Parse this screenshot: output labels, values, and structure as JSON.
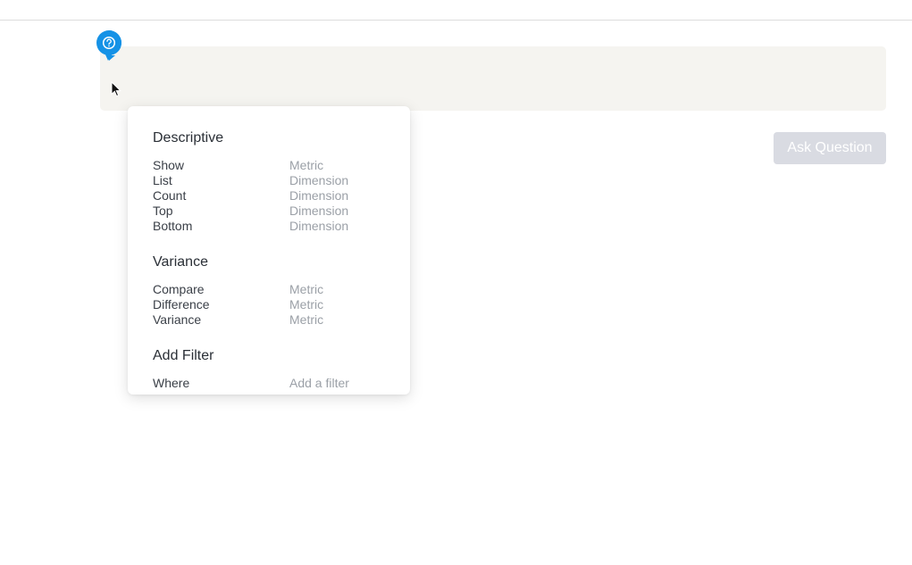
{
  "ask_button": {
    "label": "Ask Question"
  },
  "colors": {
    "accent": "#1592e6",
    "question_bar": "#f5f4f0",
    "button_disabled": "#d9dbe2"
  },
  "icons": {
    "help": "question-speech-bubble-icon",
    "cursor": "mouse-pointer-icon"
  },
  "syntax_help": {
    "sections": [
      {
        "title": "Descriptive",
        "rows": [
          {
            "keyword": "Show",
            "type": "Metric"
          },
          {
            "keyword": "List",
            "type": "Dimension"
          },
          {
            "keyword": "Count",
            "type": "Dimension"
          },
          {
            "keyword": "Top",
            "type": "Dimension"
          },
          {
            "keyword": "Bottom",
            "type": "Dimension"
          }
        ]
      },
      {
        "title": "Variance",
        "rows": [
          {
            "keyword": "Compare",
            "type": "Metric"
          },
          {
            "keyword": "Difference",
            "type": "Metric"
          },
          {
            "keyword": "Variance",
            "type": "Metric"
          }
        ]
      },
      {
        "title": "Add Filter",
        "rows": [
          {
            "keyword": "Where",
            "type": "Add a filter"
          }
        ]
      }
    ]
  }
}
